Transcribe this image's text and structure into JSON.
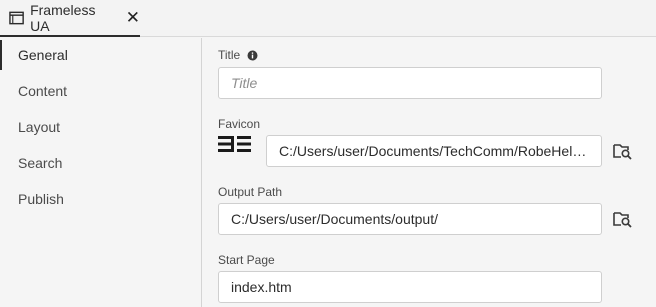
{
  "tab": {
    "title": "Frameless UA",
    "icon": "window-icon",
    "close_label": "✕"
  },
  "sidebar": {
    "items": [
      {
        "label": "General",
        "active": true
      },
      {
        "label": "Content",
        "active": false
      },
      {
        "label": "Layout",
        "active": false
      },
      {
        "label": "Search",
        "active": false
      },
      {
        "label": "Publish",
        "active": false
      }
    ]
  },
  "form": {
    "title": {
      "label": "Title",
      "placeholder": "Title",
      "value": "",
      "icon": "info-icon"
    },
    "favicon": {
      "label": "Favicon",
      "value": "C:/Users/user/Documents/TechComm/RobeHelp/BJ...",
      "logo_icon": "favicon-logo",
      "browse_icon": "browse-folder-icon"
    },
    "output_path": {
      "label": "Output Path",
      "value": "C:/Users/user/Documents/output/",
      "browse_icon": "browse-folder-icon"
    },
    "start_page": {
      "label": "Start Page",
      "value": "index.htm"
    }
  },
  "colors": {
    "accent": "#2c2c2c",
    "background": "#f5f5f5",
    "input_bg": "#ffffff",
    "border": "#cfcfcf"
  }
}
